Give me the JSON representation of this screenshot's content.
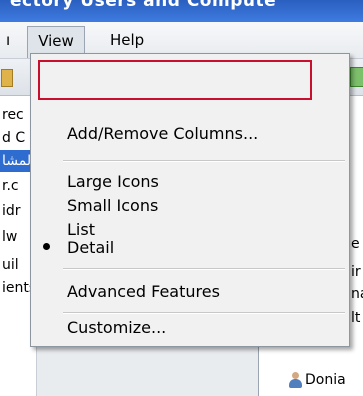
{
  "menubar": {
    "frag_label": "ı",
    "view_label": "View",
    "help_label": "Help"
  },
  "view_menu": {
    "items": [
      {
        "label": "Add/Remove Columns...",
        "highlighted": true
      },
      {
        "label": "Large Icons"
      },
      {
        "label": "Small Icons"
      },
      {
        "label": "List"
      },
      {
        "label": "Detail",
        "checked": true
      },
      {
        "label": "Advanced Features"
      },
      {
        "label": "Customize..."
      }
    ]
  },
  "left_tree": [
    "rec",
    "d C",
    "لمشا",
    "r.c",
    "idr",
    "lw",
    "uil",
    "ients"
  ],
  "right_list": [
    "e",
    "ir",
    "na",
    "lt",
    "Donia"
  ],
  "colors": {
    "highlight_border": "#c8102e",
    "selection": "#2f6ccf"
  }
}
